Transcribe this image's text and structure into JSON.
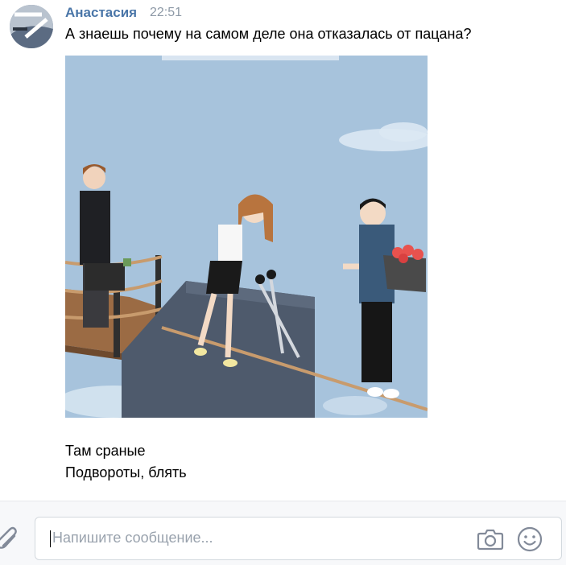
{
  "message": {
    "author": "Анастасия",
    "time": "22:51",
    "text": "А знаешь почему на самом деле она отказалась от пацана?",
    "image_icon": "comic-image",
    "lines": [
      "Там сраные",
      "Подвороты, блять"
    ]
  },
  "composer": {
    "placeholder": "Напишите сообщение...",
    "attach_icon": "paperclip-icon",
    "camera_icon": "camera-icon",
    "emoji_icon": "smile-icon"
  },
  "colors": {
    "author": "#4a76a8",
    "time": "#8d99a6",
    "placeholder": "#99a2ad"
  }
}
